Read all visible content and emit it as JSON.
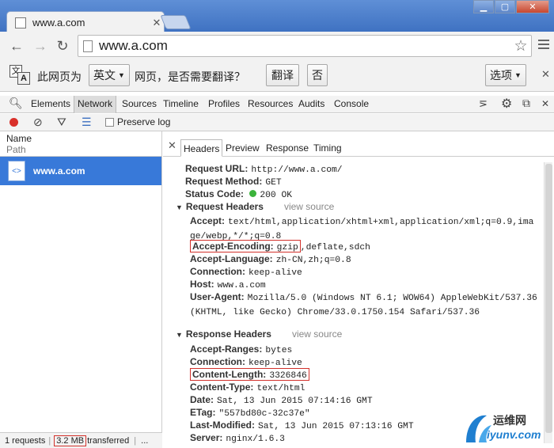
{
  "browser": {
    "tab_title": "www.a.com",
    "url": "www.a.com"
  },
  "translate": {
    "prefix": "此网页为",
    "language": "英文",
    "question": "网页，是否需要翻译？",
    "translate_btn": "翻译",
    "no_btn": "否",
    "options_btn": "选项"
  },
  "devtools": {
    "tabs": [
      "Elements",
      "Network",
      "Sources",
      "Timeline",
      "Profiles",
      "Resources",
      "Audits",
      "Console"
    ],
    "preserve_log": "Preserve log"
  },
  "request_list": {
    "col_name": "Name",
    "col_path": "Path",
    "row_name": "www.a.com"
  },
  "status": {
    "requests": "1 requests",
    "size": "3.2 MB",
    "transferred": "transferred",
    "ellipsis": "..."
  },
  "detail_tabs": [
    "Headers",
    "Preview",
    "Response",
    "Timing"
  ],
  "general": {
    "url_key": "Request URL:",
    "url_val": "http://www.a.com/",
    "method_key": "Request Method:",
    "method_val": "GET",
    "status_key": "Status Code:",
    "status_val": "200 OK"
  },
  "sections": {
    "request": "Request Headers",
    "response": "Response Headers",
    "view_source": "view source"
  },
  "request_headers": [
    {
      "k": "Accept:",
      "v": "text/html,application/xhtml+xml,application/xml;q=0.9,image/webp,*/*;q=0.8"
    },
    {
      "k": "Accept-Encoding:",
      "v1": "gzip",
      "v2": ",deflate,sdch"
    },
    {
      "k": "Accept-Language:",
      "v": "zh-CN,zh;q=0.8"
    },
    {
      "k": "Connection:",
      "v": "keep-alive"
    },
    {
      "k": "Host:",
      "v": "www.a.com"
    },
    {
      "k": "User-Agent:",
      "v": "Mozilla/5.0 (Windows NT 6.1; WOW64) AppleWebKit/537.36 (KHTML, like Gecko) Chrome/33.0.1750.154 Safari/537.36"
    }
  ],
  "response_headers": [
    {
      "k": "Accept-Ranges:",
      "v": "bytes"
    },
    {
      "k": "Connection:",
      "v": "keep-alive"
    },
    {
      "k": "Content-Length:",
      "v": "3326846"
    },
    {
      "k": "Content-Type:",
      "v": "text/html"
    },
    {
      "k": "Date:",
      "v": "Sat, 13 Jun 2015 07:14:16 GMT"
    },
    {
      "k": "ETag:",
      "v": "\"557bd80c-32c37e\""
    },
    {
      "k": "Last-Modified:",
      "v": "Sat, 13 Jun 2015 07:13:16 GMT"
    },
    {
      "k": "Server:",
      "v": "nginx/1.6.3"
    }
  ],
  "watermark": {
    "cn": "运维网",
    "url": "iyunv.com"
  },
  "colors": {
    "selection": "#3879d9",
    "highlight_box": "#d2312b",
    "record": "#d9302a",
    "status_ok": "#3bb33b"
  }
}
